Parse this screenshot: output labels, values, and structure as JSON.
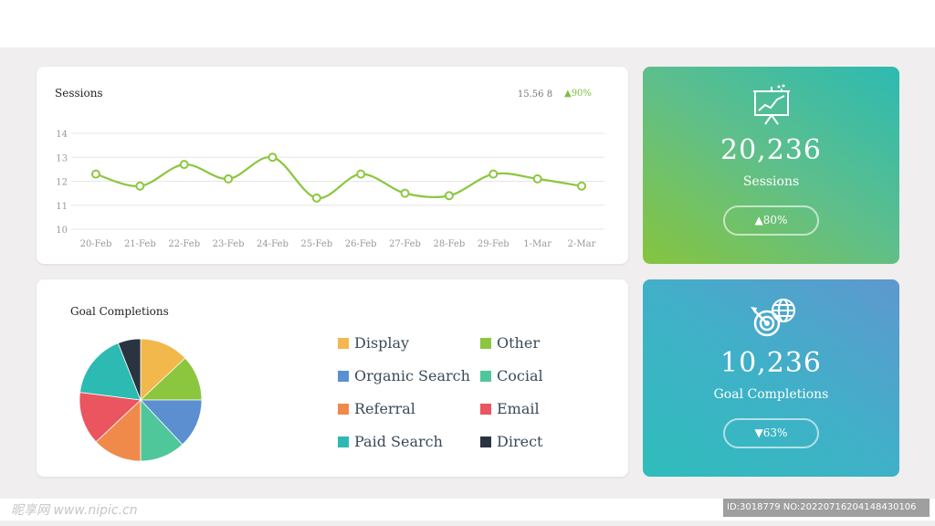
{
  "sessions_card": {
    "title": "Sessions",
    "stat_value": "15.56 8",
    "stat_change": "▲90%"
  },
  "goals_card": {
    "title": "Goal Completions"
  },
  "kpi_sessions": {
    "icon": "presentation-chart-icon",
    "value": "20,236",
    "label": "Sessions",
    "change": "▲80%"
  },
  "kpi_goals": {
    "icon": "target-globe-icon",
    "value": "10,236",
    "label": "Goal Completions",
    "change": "▼63%"
  },
  "colors": {
    "line": "#8cc63f",
    "gridline": "#e6e6e6"
  },
  "chart_data": [
    {
      "type": "line",
      "title": "Sessions",
      "categories": [
        "20-Feb",
        "21-Feb",
        "22-Feb",
        "23-Feb",
        "24-Feb",
        "25-Feb",
        "26-Feb",
        "27-Feb",
        "28-Feb",
        "29-Feb",
        "1-Mar",
        "2-Mar"
      ],
      "series": [
        {
          "values": [
            12.3,
            11.8,
            12.7,
            12.1,
            13.0,
            11.3,
            12.3,
            11.5,
            11.4,
            12.3,
            12.1,
            11.8
          ]
        }
      ],
      "yticks": [
        10,
        11,
        12,
        13,
        14
      ],
      "ylim": [
        10,
        14
      ],
      "grid": true
    },
    {
      "type": "pie",
      "title": "Goal Completions",
      "slices": [
        {
          "label": "Display",
          "value": 13,
          "color": "#f2b84b"
        },
        {
          "label": "Other",
          "value": 12,
          "color": "#8cc63f"
        },
        {
          "label": "Organic Search",
          "value": 13,
          "color": "#5b8fd0"
        },
        {
          "label": "Cocial",
          "value": 12,
          "color": "#4fc79a"
        },
        {
          "label": "Referral",
          "value": 13,
          "color": "#f08a4b"
        },
        {
          "label": "Email",
          "value": 14,
          "color": "#ea5560"
        },
        {
          "label": "Paid Search",
          "value": 17,
          "color": "#2dbab2"
        },
        {
          "label": "Direct",
          "value": 6,
          "color": "#2a3340"
        }
      ],
      "legend_order": [
        "Display",
        "Other",
        "Organic Search",
        "Cocial",
        "Referral",
        "Email",
        "Paid Search",
        "Direct"
      ]
    }
  ],
  "watermark": {
    "left": "昵享网 www.nipic.cn",
    "id": "ID:3018779 NO:20220716204148430106"
  }
}
